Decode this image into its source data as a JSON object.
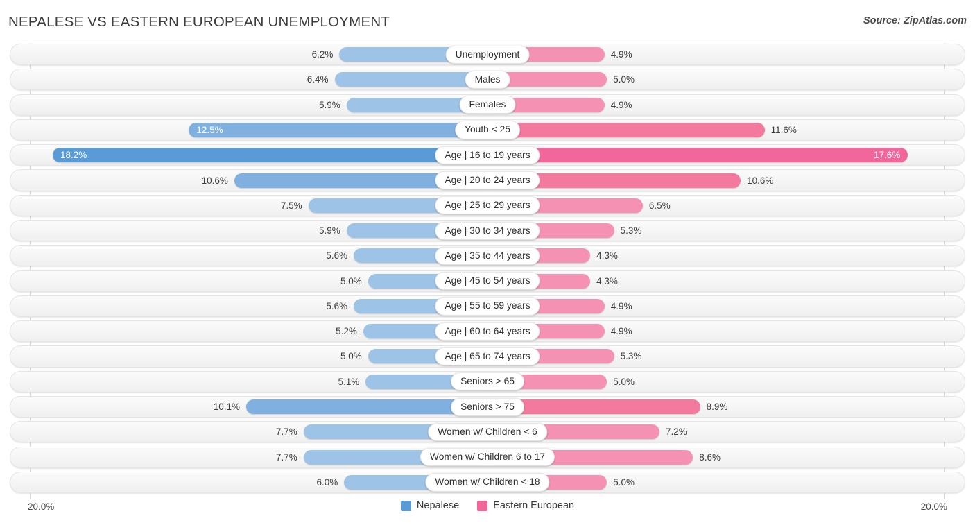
{
  "header": {
    "title": "NEPALESE VS EASTERN EUROPEAN UNEMPLOYMENT",
    "source": "Source: ZipAtlas.com"
  },
  "axis": {
    "left_max": "20.0%",
    "right_max": "20.0%"
  },
  "legend": [
    {
      "label": "Nepalese",
      "color": "#5b9bd5"
    },
    {
      "label": "Eastern European",
      "color": "#f2679b"
    }
  ],
  "chart_data": {
    "type": "bar",
    "orientation": "horizontal-diverging",
    "title": "NEPALESE VS EASTERN EUROPEAN UNEMPLOYMENT",
    "xlabel": "",
    "ylabel": "",
    "xlim": [
      0,
      20
    ],
    "axis_max_label": "20.0%",
    "grid": false,
    "legend_position": "bottom-center",
    "categories": [
      "Unemployment",
      "Males",
      "Females",
      "Youth < 25",
      "Age | 16 to 19 years",
      "Age | 20 to 24 years",
      "Age | 25 to 29 years",
      "Age | 30 to 34 years",
      "Age | 35 to 44 years",
      "Age | 45 to 54 years",
      "Age | 55 to 59 years",
      "Age | 60 to 64 years",
      "Age | 65 to 74 years",
      "Seniors > 65",
      "Seniors > 75",
      "Women w/ Children < 6",
      "Women w/ Children 6 to 17",
      "Women w/ Children < 18"
    ],
    "series": [
      {
        "name": "Nepalese",
        "color": "#5b9bd5",
        "values": [
          6.2,
          6.4,
          5.9,
          12.5,
          18.2,
          10.6,
          7.5,
          5.9,
          5.6,
          5.0,
          5.6,
          5.2,
          5.0,
          5.1,
          10.1,
          7.7,
          7.7,
          6.0
        ],
        "labels": [
          "6.2%",
          "6.4%",
          "5.9%",
          "12.5%",
          "18.2%",
          "10.6%",
          "7.5%",
          "5.9%",
          "5.6%",
          "5.0%",
          "5.6%",
          "5.2%",
          "5.0%",
          "5.1%",
          "10.1%",
          "7.7%",
          "7.7%",
          "6.0%"
        ]
      },
      {
        "name": "Eastern European",
        "color": "#f2679b",
        "values": [
          4.9,
          5.0,
          4.9,
          11.6,
          17.6,
          10.6,
          6.5,
          5.3,
          4.3,
          4.3,
          4.9,
          4.9,
          5.3,
          5.0,
          8.9,
          7.2,
          8.6,
          5.0
        ],
        "labels": [
          "4.9%",
          "5.0%",
          "4.9%",
          "11.6%",
          "17.6%",
          "10.6%",
          "6.5%",
          "5.3%",
          "4.3%",
          "4.3%",
          "4.9%",
          "4.9%",
          "5.3%",
          "5.0%",
          "8.9%",
          "7.2%",
          "8.6%",
          "5.0%"
        ]
      }
    ]
  },
  "rows": [
    {
      "label": "Unemployment",
      "left": 6.2,
      "left_label": "6.2%",
      "right": 4.9,
      "right_label": "4.9%",
      "emphasis": "normal"
    },
    {
      "label": "Males",
      "left": 6.4,
      "left_label": "6.4%",
      "right": 5.0,
      "right_label": "5.0%",
      "emphasis": "normal"
    },
    {
      "label": "Females",
      "left": 5.9,
      "left_label": "5.9%",
      "right": 4.9,
      "right_label": "4.9%",
      "emphasis": "normal"
    },
    {
      "label": "Youth < 25",
      "left": 12.5,
      "left_label": "12.5%",
      "right": 11.6,
      "right_label": "11.6%",
      "emphasis": "semi",
      "left_inside": true
    },
    {
      "label": "Age | 16 to 19 years",
      "left": 18.2,
      "left_label": "18.2%",
      "right": 17.6,
      "right_label": "17.6%",
      "emphasis": "high",
      "left_inside": true,
      "right_inside": true
    },
    {
      "label": "Age | 20 to 24 years",
      "left": 10.6,
      "left_label": "10.6%",
      "right": 10.6,
      "right_label": "10.6%",
      "emphasis": "semi"
    },
    {
      "label": "Age | 25 to 29 years",
      "left": 7.5,
      "left_label": "7.5%",
      "right": 6.5,
      "right_label": "6.5%",
      "emphasis": "normal"
    },
    {
      "label": "Age | 30 to 34 years",
      "left": 5.9,
      "left_label": "5.9%",
      "right": 5.3,
      "right_label": "5.3%",
      "emphasis": "normal"
    },
    {
      "label": "Age | 35 to 44 years",
      "left": 5.6,
      "left_label": "5.6%",
      "right": 4.3,
      "right_label": "4.3%",
      "emphasis": "normal"
    },
    {
      "label": "Age | 45 to 54 years",
      "left": 5.0,
      "left_label": "5.0%",
      "right": 4.3,
      "right_label": "4.3%",
      "emphasis": "normal"
    },
    {
      "label": "Age | 55 to 59 years",
      "left": 5.6,
      "left_label": "5.6%",
      "right": 4.9,
      "right_label": "4.9%",
      "emphasis": "normal"
    },
    {
      "label": "Age | 60 to 64 years",
      "left": 5.2,
      "left_label": "5.2%",
      "right": 4.9,
      "right_label": "4.9%",
      "emphasis": "normal"
    },
    {
      "label": "Age | 65 to 74 years",
      "left": 5.0,
      "left_label": "5.0%",
      "right": 5.3,
      "right_label": "5.3%",
      "emphasis": "normal"
    },
    {
      "label": "Seniors > 65",
      "left": 5.1,
      "left_label": "5.1%",
      "right": 5.0,
      "right_label": "5.0%",
      "emphasis": "normal"
    },
    {
      "label": "Seniors > 75",
      "left": 10.1,
      "left_label": "10.1%",
      "right": 8.9,
      "right_label": "8.9%",
      "emphasis": "semi"
    },
    {
      "label": "Women w/ Children < 6",
      "left": 7.7,
      "left_label": "7.7%",
      "right": 7.2,
      "right_label": "7.2%",
      "emphasis": "normal"
    },
    {
      "label": "Women w/ Children 6 to 17",
      "left": 7.7,
      "left_label": "7.7%",
      "right": 8.6,
      "right_label": "8.6%",
      "emphasis": "normal"
    },
    {
      "label": "Women w/ Children < 18",
      "left": 6.0,
      "left_label": "6.0%",
      "right": 5.0,
      "right_label": "5.0%",
      "emphasis": "normal"
    }
  ]
}
